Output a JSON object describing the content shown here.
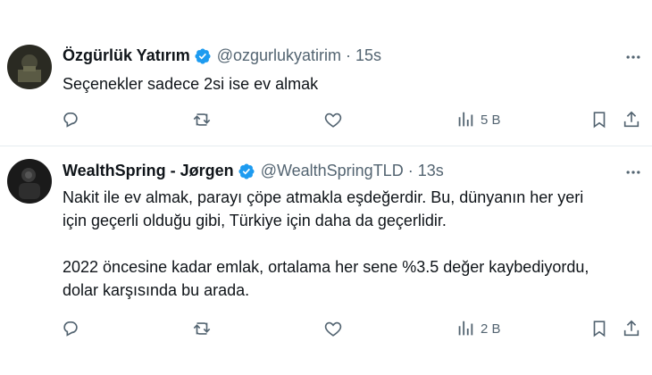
{
  "tweets": [
    {
      "name": "Özgürlük Yatırım",
      "handle": "@ozgurlukyatirim",
      "separator": "·",
      "time": "15s",
      "text": "Seçenekler sadece 2si ise ev almak",
      "views": "5 B",
      "avatar": "dark-photo-avatar"
    },
    {
      "name": "WealthSpring - Jørgen",
      "handle": "@WealthSpringTLD",
      "separator": "·",
      "time": "13s",
      "text": "Nakit ile ev almak, parayı çöpe atmakla eşdeğerdir. Bu, dünyanın her yeri\niçin geçerli olduğu gibi, Türkiye için daha da geçerlidir.\n\n2022 öncesine kadar emlak, ortalama her sene %3.5 değer kaybediyordu,\ndolar karşısında bu arada.",
      "views": "2 B",
      "avatar": "dark-photo-avatar"
    }
  ],
  "icons": {
    "verified": "verified-badge-icon",
    "more": "more-horizontal-icon",
    "reply": "reply-icon",
    "retweet": "retweet-icon",
    "like": "like-icon",
    "views": "views-icon",
    "bookmark": "bookmark-icon",
    "share": "share-icon"
  },
  "colors": {
    "verified_blue": "#1d9bf0",
    "secondary_text": "#536471",
    "icon_gray": "#536471",
    "divider": "#e6ecf0"
  }
}
